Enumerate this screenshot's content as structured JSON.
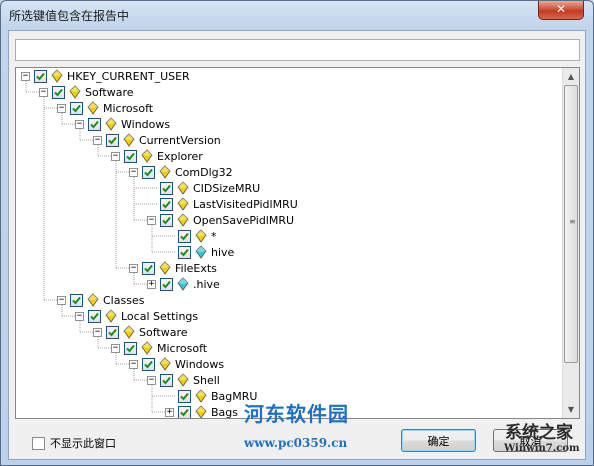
{
  "window": {
    "title": "所选键值包含在报告中",
    "close_glyph": "✕"
  },
  "search": {
    "value": "",
    "placeholder": ""
  },
  "tree": [
    {
      "label": "HKEY_CURRENT_USER",
      "depth": 0,
      "expander": "minus",
      "icon": "yellow",
      "checked": true
    },
    {
      "label": "Software",
      "depth": 1,
      "expander": "minus",
      "icon": "yellow",
      "checked": true
    },
    {
      "label": "Microsoft",
      "depth": 2,
      "expander": "minus",
      "icon": "yellow",
      "checked": true
    },
    {
      "label": "Windows",
      "depth": 3,
      "expander": "minus",
      "icon": "yellow",
      "checked": true
    },
    {
      "label": "CurrentVersion",
      "depth": 4,
      "expander": "minus",
      "icon": "yellow",
      "checked": true
    },
    {
      "label": "Explorer",
      "depth": 5,
      "expander": "minus",
      "icon": "yellow",
      "checked": true
    },
    {
      "label": "ComDlg32",
      "depth": 6,
      "expander": "minus",
      "icon": "yellow",
      "checked": true
    },
    {
      "label": "CIDSizeMRU",
      "depth": 7,
      "expander": "none",
      "icon": "yellow",
      "checked": true
    },
    {
      "label": "LastVisitedPidlMRU",
      "depth": 7,
      "expander": "none",
      "icon": "yellow",
      "checked": true
    },
    {
      "label": "OpenSavePidlMRU",
      "depth": 7,
      "expander": "minus",
      "icon": "yellow",
      "checked": true
    },
    {
      "label": "*",
      "depth": 8,
      "expander": "none",
      "icon": "yellow",
      "checked": true
    },
    {
      "label": "hive",
      "depth": 8,
      "expander": "none",
      "icon": "cyan",
      "checked": true
    },
    {
      "label": "FileExts",
      "depth": 6,
      "expander": "minus",
      "icon": "yellow",
      "checked": true
    },
    {
      "label": ".hive",
      "depth": 7,
      "expander": "plus",
      "icon": "cyan",
      "checked": true
    },
    {
      "label": "Classes",
      "depth": 2,
      "expander": "minus",
      "icon": "yellow",
      "checked": true
    },
    {
      "label": "Local Settings",
      "depth": 3,
      "expander": "minus",
      "icon": "yellow",
      "checked": true
    },
    {
      "label": "Software",
      "depth": 4,
      "expander": "minus",
      "icon": "yellow",
      "checked": true
    },
    {
      "label": "Microsoft",
      "depth": 5,
      "expander": "minus",
      "icon": "yellow",
      "checked": true
    },
    {
      "label": "Windows",
      "depth": 6,
      "expander": "minus",
      "icon": "yellow",
      "checked": true
    },
    {
      "label": "Shell",
      "depth": 7,
      "expander": "minus",
      "icon": "yellow",
      "checked": true
    },
    {
      "label": "BagMRU",
      "depth": 8,
      "expander": "none",
      "icon": "yellow",
      "checked": true
    },
    {
      "label": "Bags",
      "depth": 8,
      "expander": "plus",
      "icon": "yellow",
      "checked": true
    }
  ],
  "footer": {
    "checkbox_label": "不显示此窗口",
    "checkbox_checked": false,
    "ok_label": "确定",
    "cancel_label": "取消"
  },
  "watermarks": {
    "left_name": "河东软件园",
    "left_url": "www.pc0359.cn",
    "right_name": "系统之家",
    "right_url": "Winwin7.com"
  },
  "colors": {
    "key_yellow": "#f0d000",
    "key_cyan": "#2fc7d9",
    "check_green": "#1c8f1c",
    "close_red": "#c8412a"
  }
}
